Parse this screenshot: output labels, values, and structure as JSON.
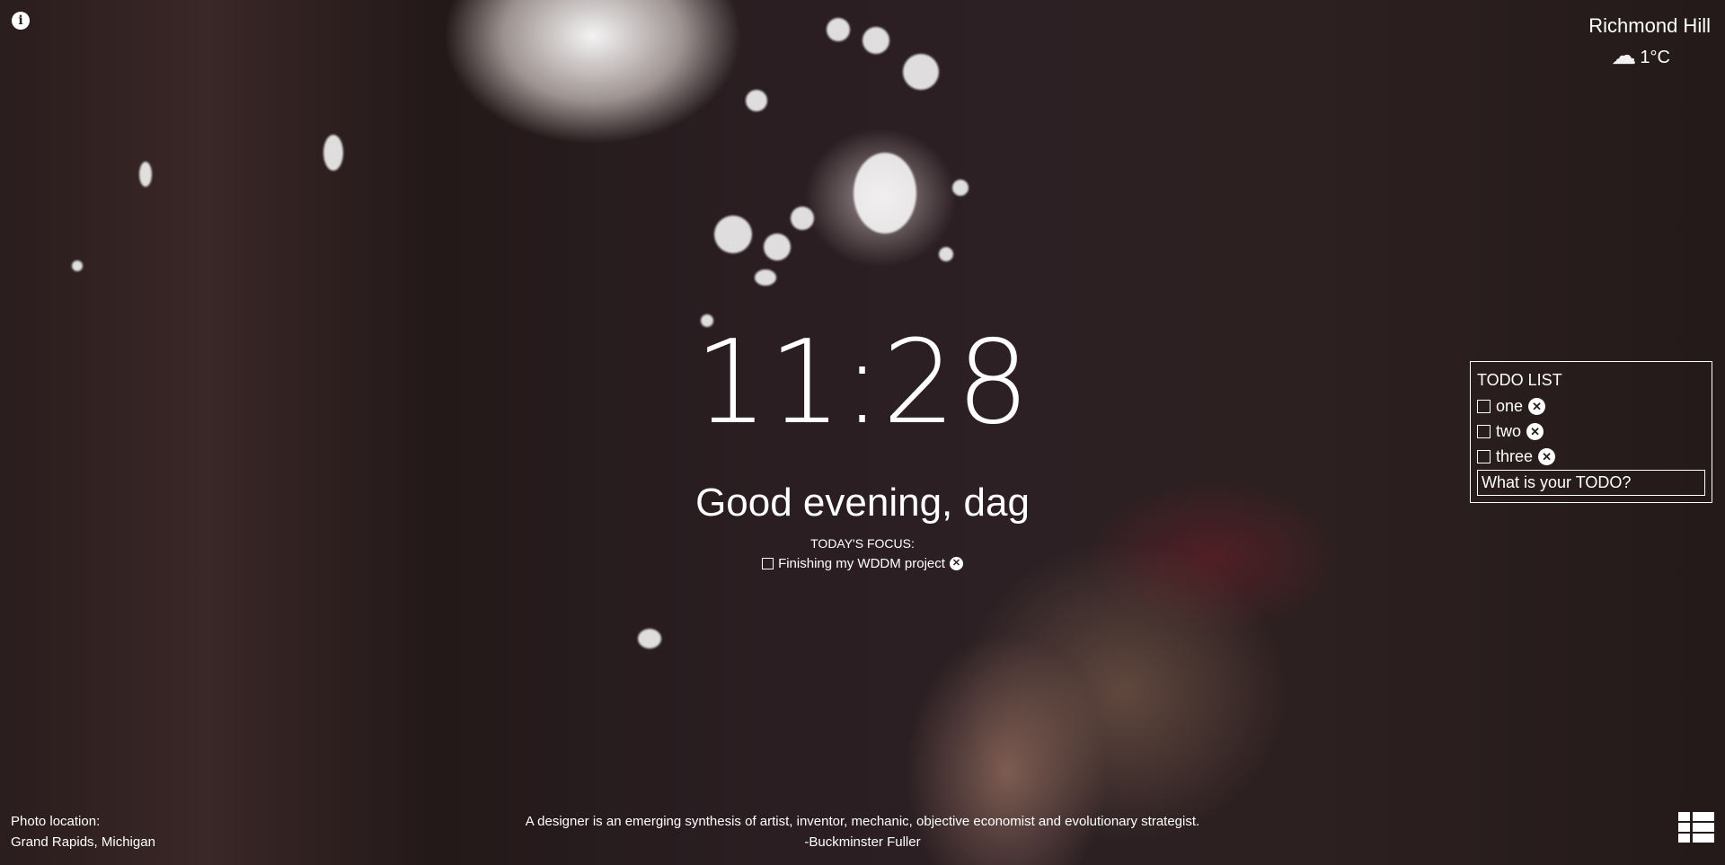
{
  "weather": {
    "city": "Richmond Hill",
    "temperature": "1°C",
    "icon": "cloud-icon"
  },
  "clock": {
    "time": "11:28"
  },
  "greeting": {
    "text": "Good evening, dag"
  },
  "focus": {
    "title": "TODAY'S FOCUS:",
    "item": "Finishing my WDDM project",
    "checked": false
  },
  "todo": {
    "title": "TODO LIST",
    "items": [
      {
        "label": "one",
        "checked": false
      },
      {
        "label": "two",
        "checked": false
      },
      {
        "label": "three",
        "checked": false
      }
    ],
    "input_placeholder": "What is your TODO?"
  },
  "photo": {
    "label": "Photo location:",
    "location": "Grand Rapids, Michigan"
  },
  "quote": {
    "text": "A designer is an emerging synthesis of artist, inventor, mechanic, objective economist and evolutionary strategist.",
    "author": "-Buckminster Fuller"
  },
  "icons": {
    "info": "info-icon",
    "close": "close-icon",
    "menu": "grid-menu-icon"
  }
}
